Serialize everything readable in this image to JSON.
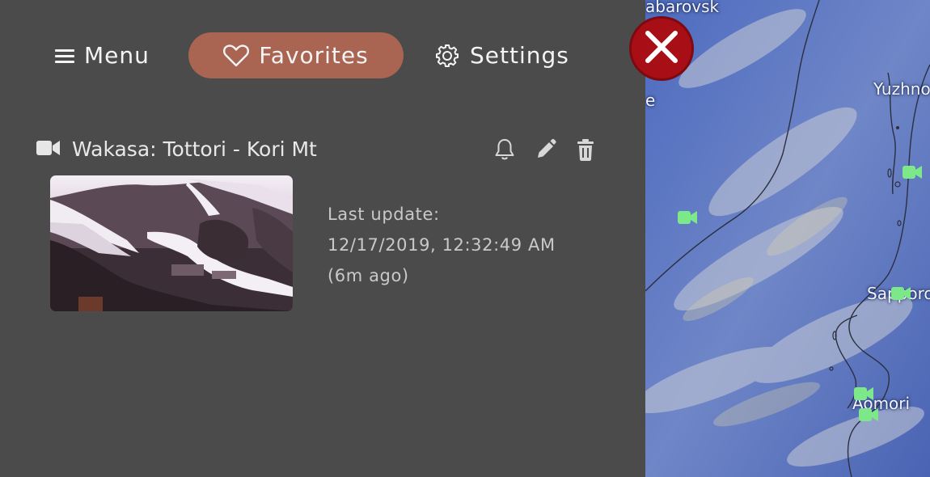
{
  "nav": {
    "menu_label": "Menu",
    "favorites_label": "Favorites",
    "settings_label": "Settings"
  },
  "favorite": {
    "title": "Wakasa: Tottori - Kori Mt",
    "update_label": "Last update:",
    "update_time": "12/17/2019, 12:32:49 AM",
    "update_ago": "(6m ago)"
  },
  "map": {
    "labels": {
      "khabarovsk": "abarovsk",
      "yuzhno": "Yuzhno",
      "sapporo": "Sapporo",
      "aomori": "Aomori",
      "left_e": "e"
    }
  },
  "colors": {
    "panel_bg": "#4b4b4b",
    "favorites_active": "#a96452",
    "close_button": "#a80e15",
    "camera_marker": "#7ce88a"
  },
  "icons": {
    "menu": "hamburger-icon",
    "favorites": "heart-icon",
    "settings": "gear-icon",
    "camera": "video-camera-icon",
    "bell": "bell-icon",
    "edit": "pencil-icon",
    "delete": "trash-icon",
    "close": "close-icon"
  }
}
